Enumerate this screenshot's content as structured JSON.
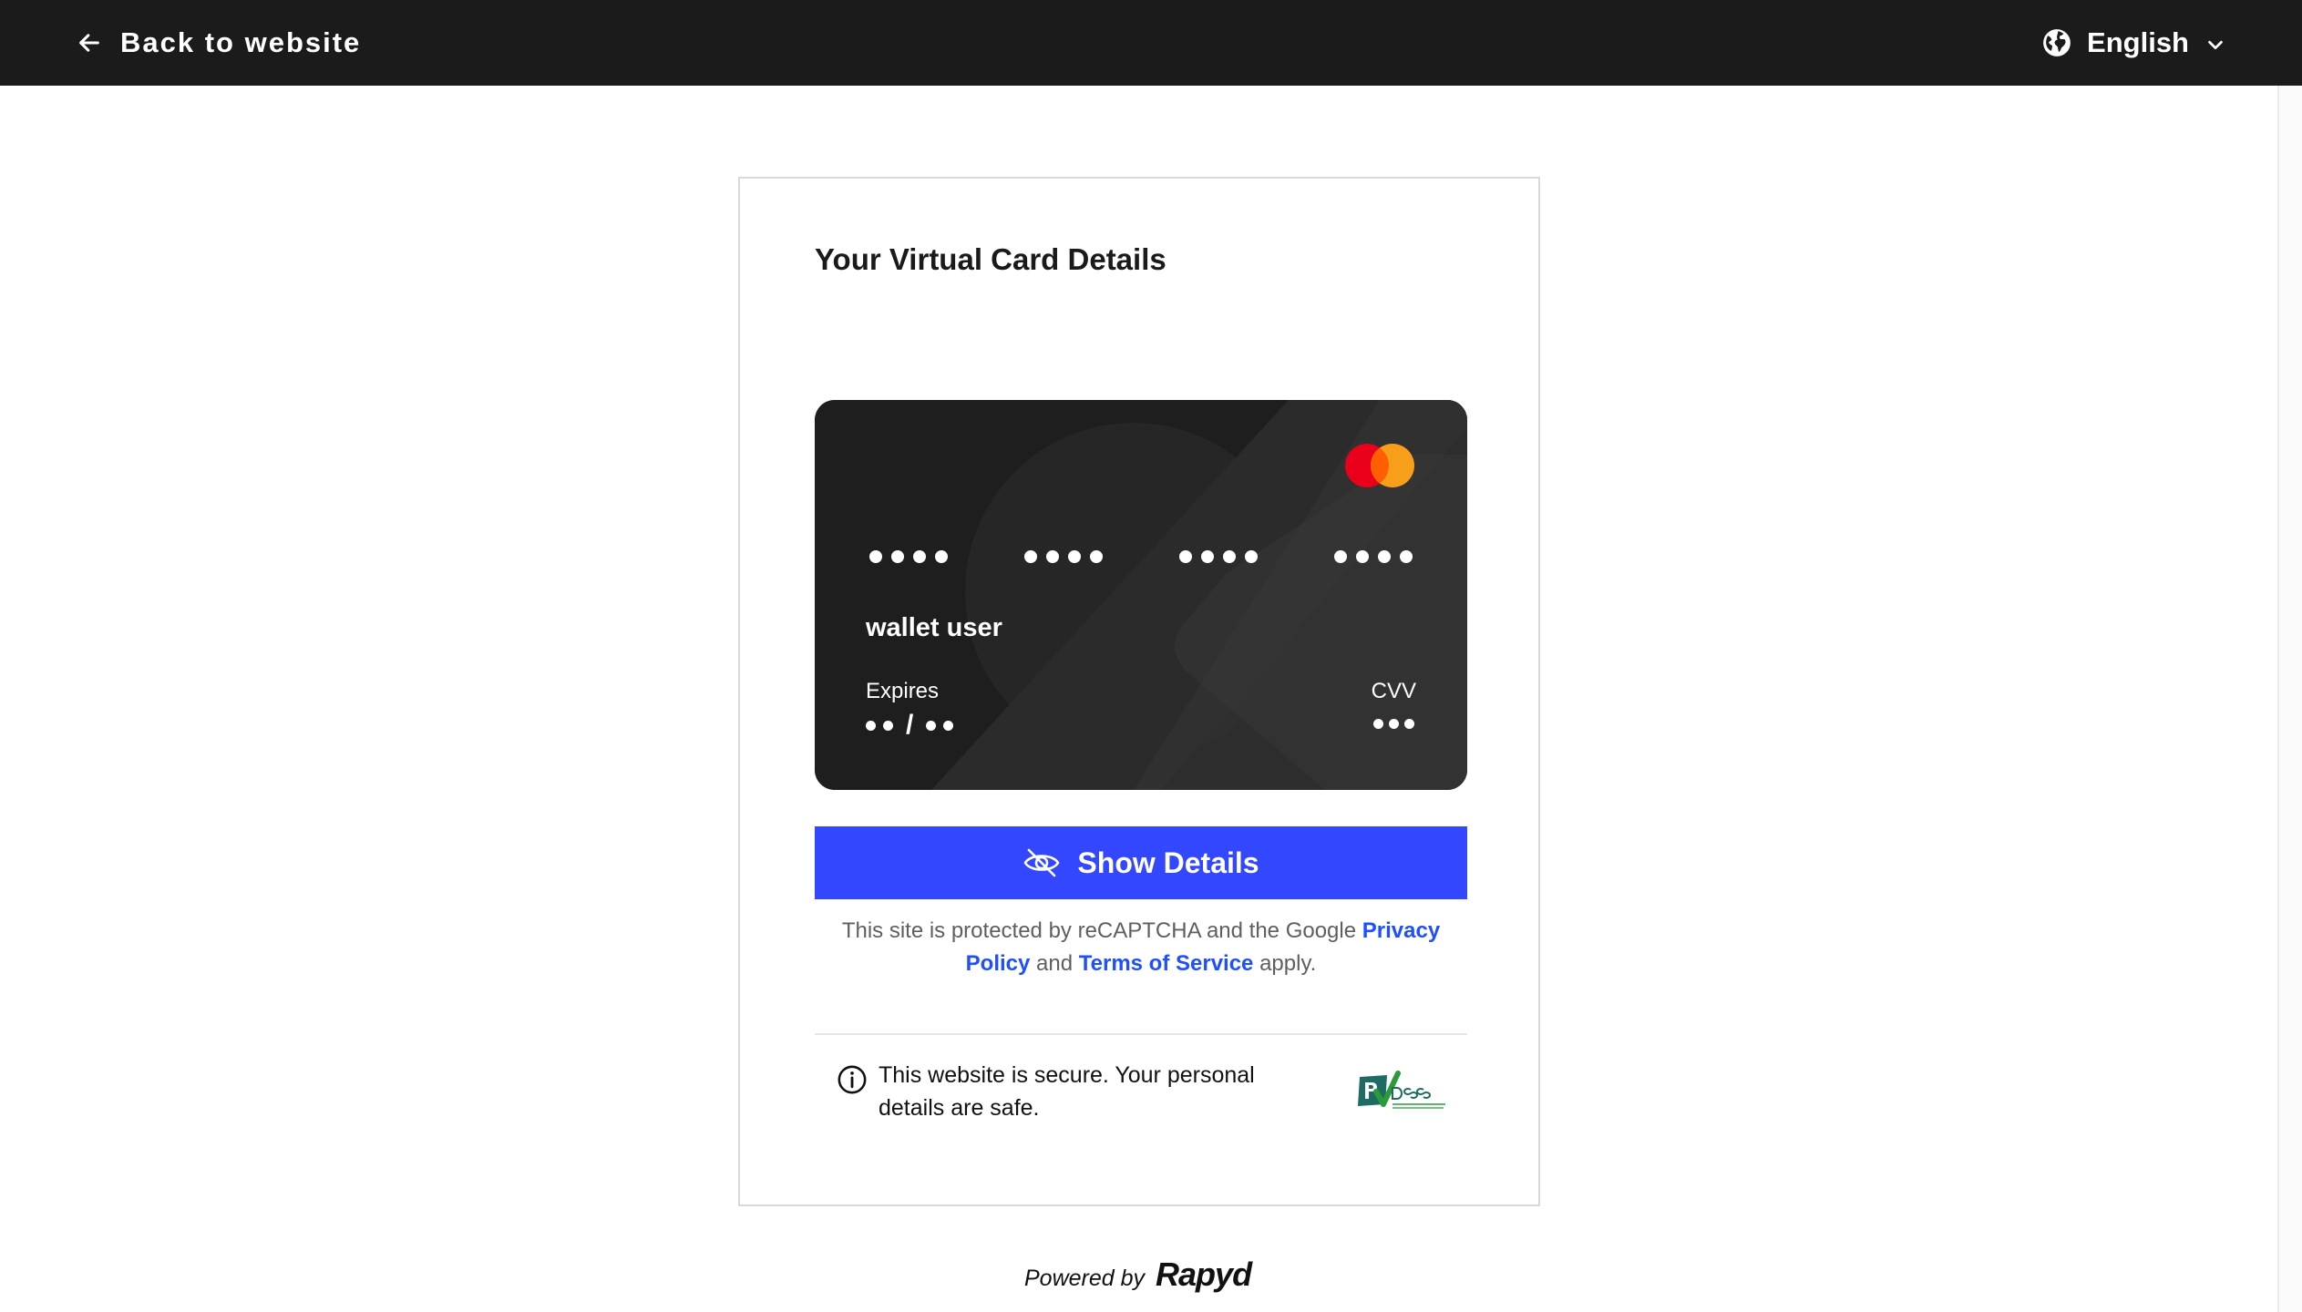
{
  "topbar": {
    "back_label": "Back to website",
    "language": "English",
    "back_icon": "arrow-left-icon",
    "language_icon": "globe-icon",
    "dropdown_icon": "chevron-down-icon",
    "background_color": "#1b1b1b"
  },
  "panel": {
    "title": "Your Virtual Card Details"
  },
  "card": {
    "brand_icon": "mastercard-logo",
    "number_groups": [
      "••••",
      "••••",
      "••••",
      "••••"
    ],
    "holder_name": "wallet user",
    "expires_label": "Expires",
    "expires_value": "•• / ••",
    "cvv_label": "CVV",
    "cvv_value": "•••",
    "background_color": "#1e1e1e"
  },
  "show_button": {
    "label": "Show Details",
    "icon": "eye-off-icon",
    "color": "#3347ff"
  },
  "recaptcha": {
    "text_before": "This site is protected by reCAPTCHA and the Google",
    "privacy_link": "Privacy Policy",
    "text_middle": "and",
    "terms_link": "Terms of Service",
    "text_after": "apply.",
    "link_color": "#1f4fff"
  },
  "security": {
    "message": "This website is secure. Your personal details are safe.",
    "info_icon": "info-icon",
    "badge": "pci-dss-certified-badge"
  },
  "footer": {
    "powered_by": "Powered by",
    "brand": "Rapyd"
  }
}
